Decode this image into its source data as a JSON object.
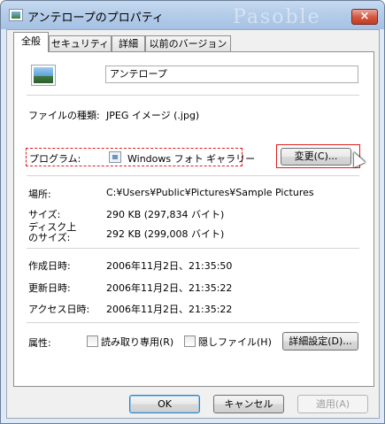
{
  "window": {
    "title": "アンテロープのプロパティ",
    "watermark": "Pasoble",
    "close_label": "×"
  },
  "tabs": [
    {
      "label": "全般"
    },
    {
      "label": "セキュリティ"
    },
    {
      "label": "詳細"
    },
    {
      "label": "以前のバージョン"
    }
  ],
  "general": {
    "file_name": "アンテロープ",
    "type_label": "ファイルの種類:",
    "type_value": "JPEG イメージ (.jpg)",
    "program_label": "プログラム:",
    "program_value": "Windows フォト ギャラリー",
    "change_button": "変更(C)...",
    "location_label": "場所:",
    "location_value": "C:¥Users¥Public¥Pictures¥Sample Pictures",
    "size_label": "サイズ:",
    "size_value": "290 KB (297,834 バイト)",
    "disk_size_label_1": "ディスク上",
    "disk_size_label_2": "のサイズ:",
    "disk_size_value": "292 KB (299,008 バイト)",
    "created_label": "作成日時:",
    "created_value": "2006年11月2日、21:35:50",
    "modified_label": "更新日時:",
    "modified_value": "2006年11月2日、21:35:22",
    "accessed_label": "アクセス日時:",
    "accessed_value": "2006年11月2日、21:35:22",
    "attributes_label": "属性:",
    "readonly_label": "読み取り専用(R)",
    "hidden_label": "隠しファイル(H)",
    "advanced_button": "詳細設定(D)..."
  },
  "footer": {
    "ok": "OK",
    "cancel": "キャンセル",
    "apply": "適用(A)"
  },
  "colors": {
    "highlight_red": "#e01b1b",
    "titlebar": "#b5cde9"
  }
}
